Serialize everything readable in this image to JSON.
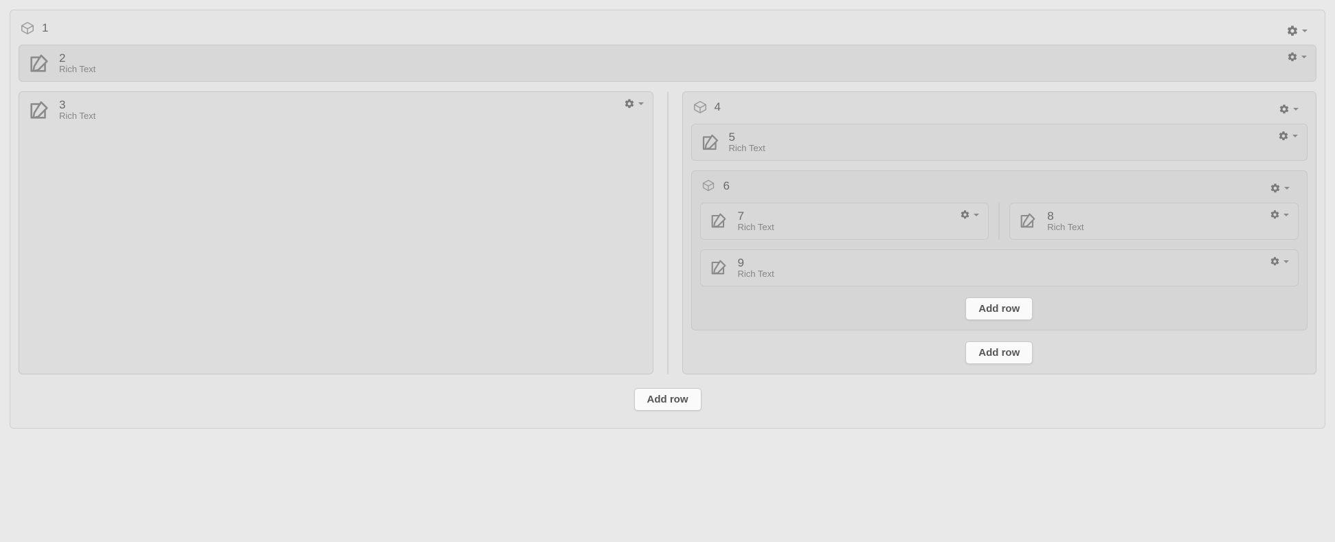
{
  "labels": {
    "add_row": "Add row",
    "rich_text": "Rich Text"
  },
  "nodes": {
    "n1": "1",
    "n2": "2",
    "n3": "3",
    "n4": "4",
    "n5": "5",
    "n6": "6",
    "n7": "7",
    "n8": "8",
    "n9": "9"
  }
}
